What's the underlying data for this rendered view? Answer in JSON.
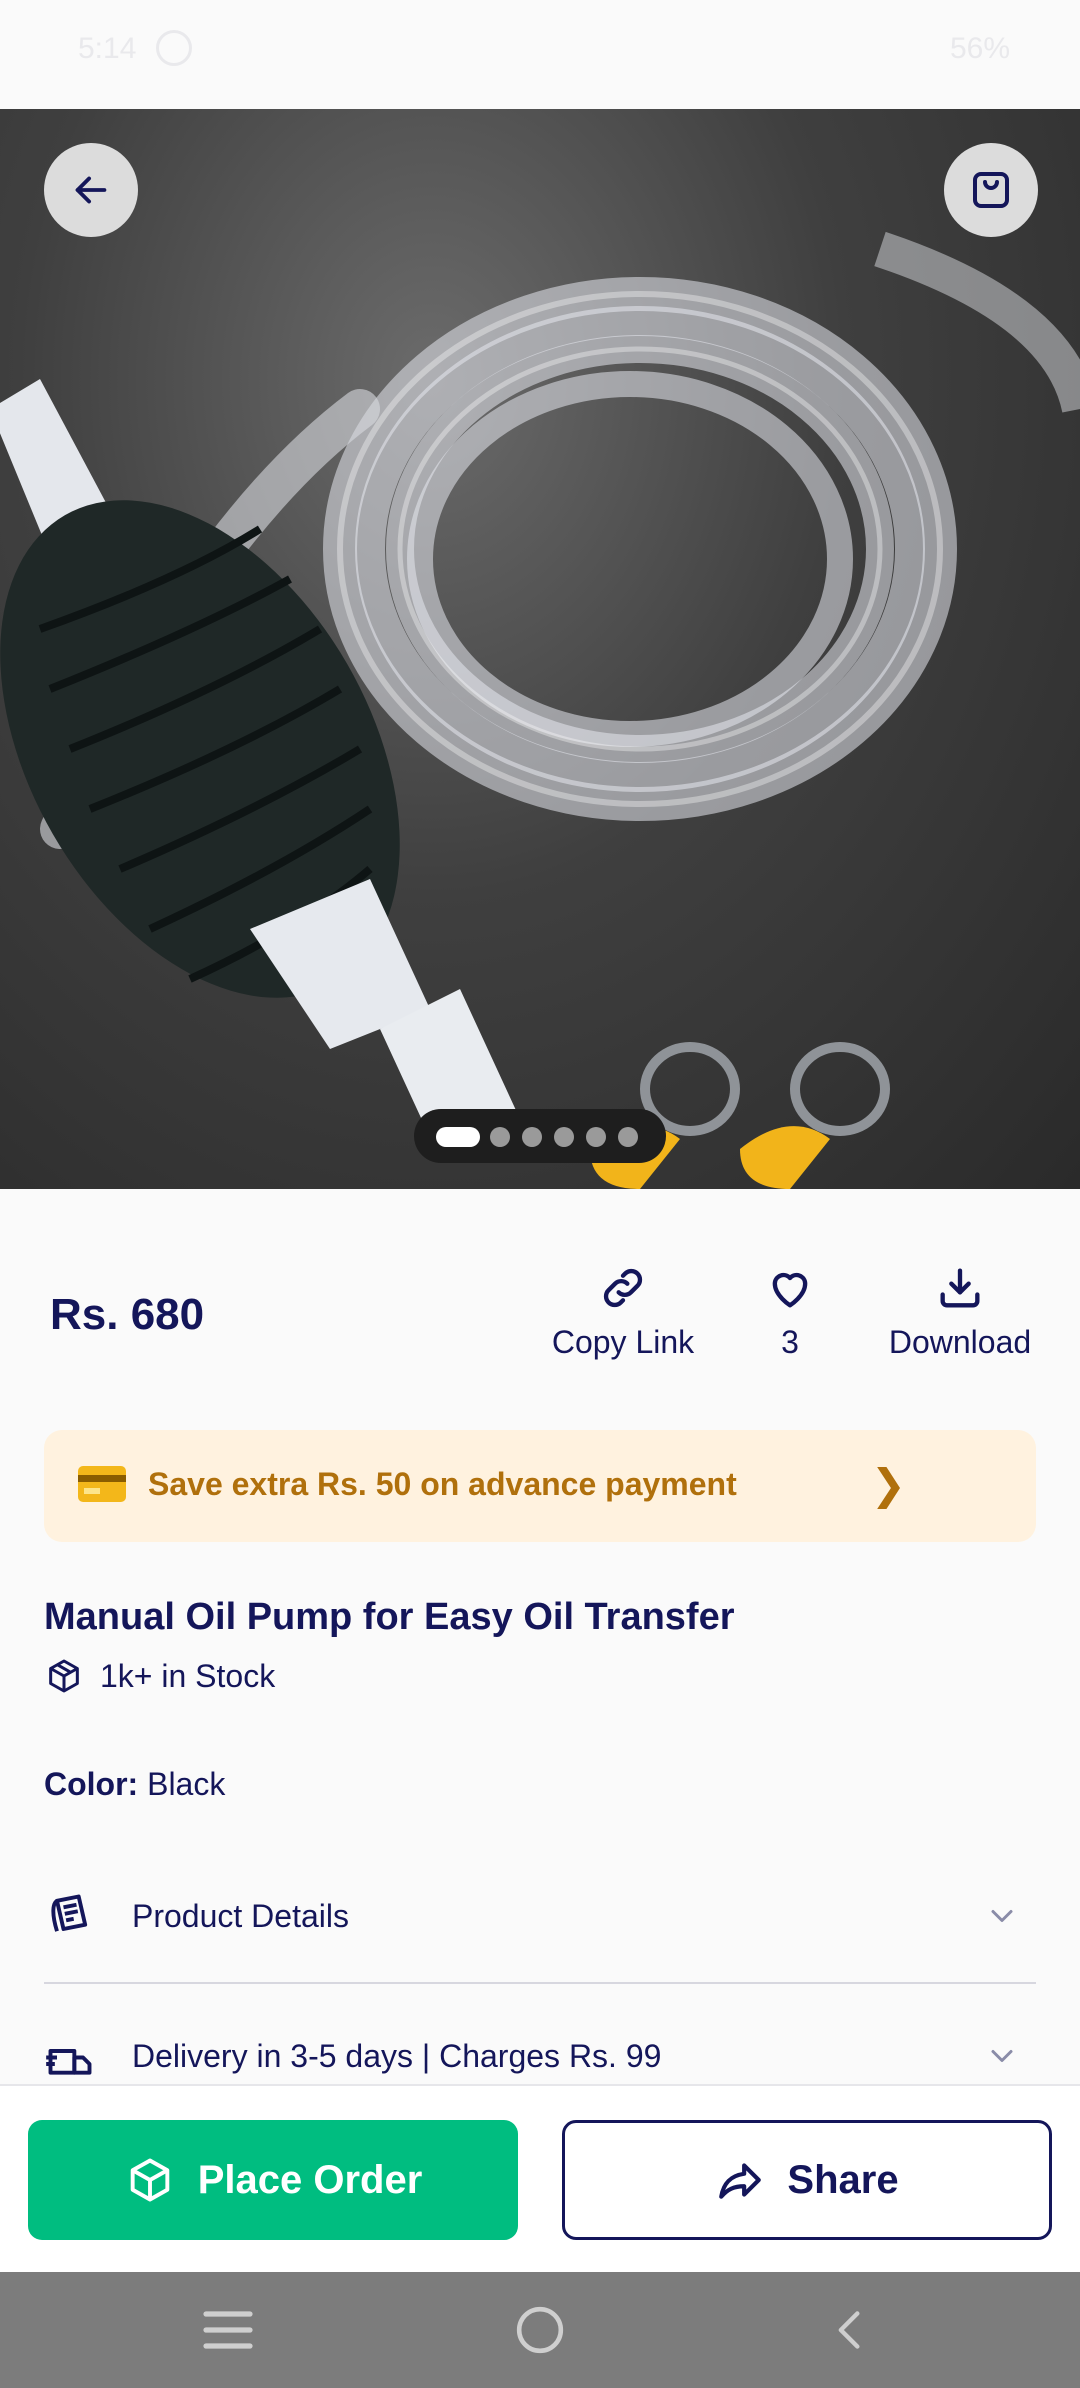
{
  "status_bar": {
    "time": "5:14",
    "right_text": "56%"
  },
  "hero": {
    "slide_count": 6,
    "active_slide": 0
  },
  "product": {
    "price": "Rs. 680",
    "title": "Manual Oil Pump for Easy Oil Transfer",
    "stock": "1k+ in Stock",
    "color_label": "Color:",
    "color_value": "Black"
  },
  "actions": {
    "copy_link": "Copy Link",
    "likes": "3",
    "download": "Download"
  },
  "promo": {
    "text": "Save extra Rs. 50 on advance payment",
    "arrow": "❯"
  },
  "accordion": {
    "product_details": "Product Details",
    "delivery": "Delivery in 3-5 days | Charges Rs. 99"
  },
  "buttons": {
    "place_order": "Place Order",
    "share": "Share"
  },
  "colors": {
    "primary_navy": "#14165a",
    "order_green": "#00bd80",
    "promo_bg": "#fff2df",
    "promo_text": "#b0700c"
  }
}
